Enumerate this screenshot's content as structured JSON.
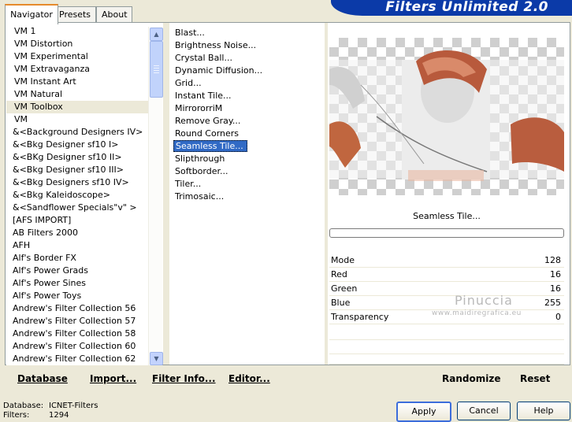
{
  "tabs": [
    {
      "label": "Navigator",
      "active": true
    },
    {
      "label": "Presets",
      "active": false
    },
    {
      "label": "About",
      "active": false
    }
  ],
  "banner": {
    "title": "Filters Unlimited 2.0"
  },
  "categories": [
    "VM 1",
    "VM Distortion",
    "VM Experimental",
    "VM Extravaganza",
    "VM Instant Art",
    "VM Natural",
    "VM Toolbox",
    "VM",
    "&<Background Designers IV>",
    "&<Bkg Designer sf10 I>",
    "&<BKg Designer sf10 II>",
    "&<Bkg Designer sf10 III>",
    "&<Bkg Designers sf10 IV>",
    "&<Bkg Kaleidoscope>",
    "&<Sandflower Specials\"v\" >",
    "[AFS IMPORT]",
    "AB Filters 2000",
    "AFH",
    "Alf's Border FX",
    "Alf's Power Grads",
    "Alf's Power Sines",
    "Alf's Power Toys",
    "Andrew's Filter Collection 56",
    "Andrew's Filter Collection 57",
    "Andrew's Filter Collection 58",
    "Andrew's Filter Collection 60",
    "Andrew's Filter Collection 62"
  ],
  "selected_category": "VM Toolbox",
  "filters": [
    "Blast...",
    "Brightness Noise...",
    "Crystal Ball...",
    "Dynamic Diffusion...",
    "Grid...",
    "Instant Tile...",
    "MirrororriM",
    "Remove Gray...",
    "Round Corners",
    "Seamless Tile...",
    "Slipthrough",
    "Softborder...",
    "Tiler...",
    "Trimosaic..."
  ],
  "selected_filter": "Seamless Tile...",
  "preview": {
    "filter_name": "Seamless Tile..."
  },
  "params": [
    {
      "label": "Mode",
      "value": "128"
    },
    {
      "label": "Red",
      "value": "16"
    },
    {
      "label": "Green",
      "value": "16"
    },
    {
      "label": "Blue",
      "value": "255"
    },
    {
      "label": "Transparency",
      "value": "0"
    }
  ],
  "watermark": {
    "name": "Pinuccia",
    "url": "www.maidiregrafica.eu"
  },
  "bottom_links": {
    "database": "Database",
    "import": "Import...",
    "filter_info": "Filter Info...",
    "editor": "Editor...",
    "randomize": "Randomize",
    "reset": "Reset"
  },
  "buttons": {
    "apply": "Apply",
    "cancel": "Cancel",
    "help": "Help"
  },
  "info": {
    "database_label": "Database:",
    "database_value": "ICNET-Filters",
    "filters_label": "Filters:",
    "filters_value": "1294"
  },
  "colors": {
    "banner": "#0b3aa8",
    "selection": "#316ac5",
    "dialog_bg": "#ece9d8"
  }
}
